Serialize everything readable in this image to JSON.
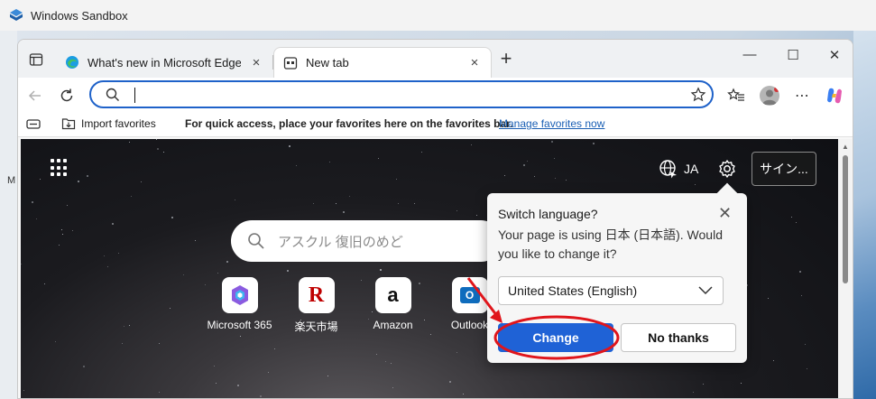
{
  "host": {
    "title": "Windows Sandbox",
    "left_glyph": "M"
  },
  "browser": {
    "tabs": [
      {
        "label": "What's new in Microsoft Edge",
        "close": "×"
      },
      {
        "label": "New tab",
        "close": "×"
      }
    ],
    "new_tab_symbol": "+",
    "window_controls": {
      "minimize": "—",
      "maximize": "☐",
      "close": "✕"
    },
    "address": {
      "value": ""
    },
    "more_symbol": "⋯"
  },
  "favorites_bar": {
    "import_label": "Import favorites",
    "hint": "For quick access, place your favorites here on the favorites bar.",
    "manage_link": "Manage favorites now"
  },
  "newtab": {
    "language_code": "JA",
    "signin_label": "サイン...",
    "search_placeholder": "アスクル 復旧のめど",
    "tiles": [
      {
        "label": "Microsoft 365",
        "icon": "microsoft-365-icon"
      },
      {
        "label": "楽天市場",
        "icon": "rakuten-icon",
        "glyph": "R"
      },
      {
        "label": "Amazon",
        "icon": "amazon-icon",
        "glyph": "a"
      },
      {
        "label": "Outlook",
        "icon": "outlook-icon",
        "glyph": "O"
      }
    ]
  },
  "language_popup": {
    "title": "Switch language?",
    "body": "Your page is using 日本 (日本語). Would you like to change it?",
    "selected_language": "United States (English)",
    "change_label": "Change",
    "no_thanks_label": "No thanks",
    "close_symbol": "✕"
  },
  "colors": {
    "accent": "#1f62d6",
    "annotation_red": "#e0151b",
    "address_focus": "#1f62c9"
  }
}
